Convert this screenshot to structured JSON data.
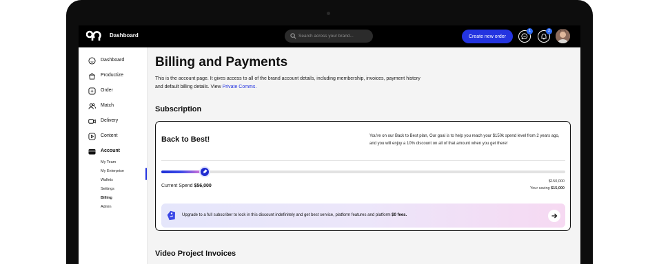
{
  "header": {
    "title": "Dashboard",
    "search_placeholder": "Search across your brand...",
    "create_button": "Create new order",
    "messages_badge": "1",
    "notifications_badge": "2"
  },
  "sidebar": {
    "items": [
      {
        "label": "Dashboard",
        "icon": "smile-icon"
      },
      {
        "label": "Productize",
        "icon": "bag-icon"
      },
      {
        "label": "Order",
        "icon": "order-icon"
      },
      {
        "label": "Match",
        "icon": "users-icon"
      },
      {
        "label": "Delivery",
        "icon": "video-icon"
      },
      {
        "label": "Content",
        "icon": "play-icon"
      },
      {
        "label": "Account",
        "icon": "wallet-icon"
      }
    ],
    "subitems": [
      "My Team",
      "My Enterprise",
      "Wallets",
      "Settings",
      "Billing",
      "Admin"
    ]
  },
  "main": {
    "title": "Billing and Payments",
    "description": "This is the account page. It gives access to all of the brand account details, including membership, invoices, payment history and default billing details. View ",
    "description_link": "Private Comms.",
    "subscription_title": "Subscription",
    "plan": {
      "name": "Back to Best!",
      "description": "You're on our Back to Best plan, Our goal is to help you reach your $150k spend level from 2 years ago, and you will enjoy a 10% discount on all of that amount when you get there!",
      "current_spend_label": "Current Spend",
      "current_spend_value": "$56,000",
      "target": "$150,000",
      "saving_label": "Your saving",
      "saving_value": "$15,000",
      "progress_fraction": 0.107
    },
    "upgrade": {
      "text": "Upgrade to a full subscriber to lock in this discount indefinitely  and get best service, platform features and platform",
      "fees": "$0 fees."
    },
    "invoices_title": "Video Project Invoices"
  },
  "colors": {
    "accent": "#2434e0",
    "badge": "#2f6cf6",
    "topbar": "#000000"
  }
}
